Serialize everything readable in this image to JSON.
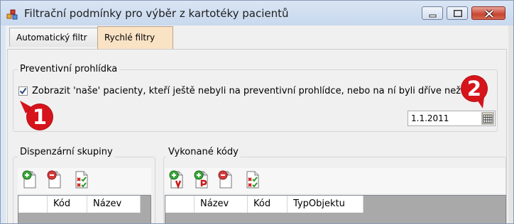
{
  "window": {
    "title": "Filtrační podmínky pro výběr z kartotéky pacientů",
    "controls": [
      "minimize",
      "maximize",
      "close"
    ]
  },
  "tabs": [
    {
      "label": "Automatický filtr",
      "active": false
    },
    {
      "label": "Rychlé filtry",
      "active": true
    }
  ],
  "preventive": {
    "group_title": "Preventivní prohlídka",
    "checkbox_checked": true,
    "checkbox_label": "Zobrazit 'naše' pacienty, kteří ještě nebyli na preventivní prohlídce, nebo na ní byli dříve než:",
    "date_value": "1.1.2011"
  },
  "markers": [
    {
      "label": "1"
    },
    {
      "label": "2"
    }
  ],
  "dispenzarni": {
    "group_title": "Dispenzární skupiny",
    "toolbar_icons": [
      "add-document-icon",
      "remove-document-icon",
      "check-document-icon"
    ],
    "columns": [
      "Kód",
      "Název"
    ]
  },
  "vykonane": {
    "group_title": "Vykonané kódy",
    "toolbar_icons": [
      "add-v-document-icon",
      "add-p-document-icon",
      "remove-document-icon",
      "check-document-icon"
    ],
    "columns": [
      "Název",
      "Kód",
      "TypObjektu"
    ]
  },
  "colors": {
    "active_tab": "#fae2c5",
    "marker": "#d6141b",
    "grid_background": "#a9a9a9"
  }
}
